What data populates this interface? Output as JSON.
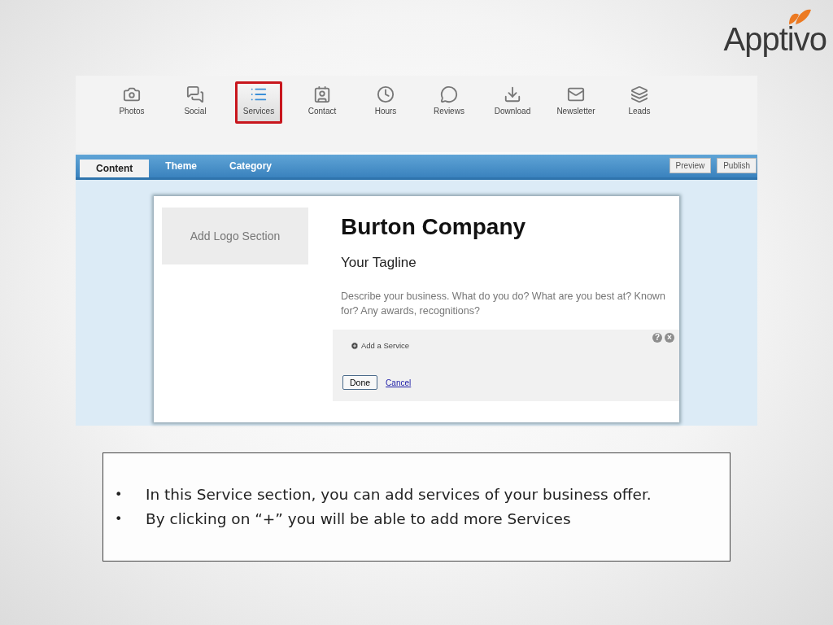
{
  "logo": {
    "text": "Apptivo"
  },
  "toolbar": {
    "items": [
      {
        "label": "Photos",
        "kind": "camera",
        "selected": false
      },
      {
        "label": "Social",
        "kind": "chat",
        "selected": false
      },
      {
        "label": "Services",
        "kind": "list",
        "selected": true
      },
      {
        "label": "Contact",
        "kind": "card",
        "selected": false
      },
      {
        "label": "Hours",
        "kind": "clock",
        "selected": false
      },
      {
        "label": "Reviews",
        "kind": "bubble",
        "selected": false
      },
      {
        "label": "Download",
        "kind": "download",
        "selected": false
      },
      {
        "label": "Newsletter",
        "kind": "mail",
        "selected": false
      },
      {
        "label": "Leads",
        "kind": "stack",
        "selected": false
      }
    ]
  },
  "tabs": [
    {
      "label": "Content",
      "selected": true
    },
    {
      "label": "Theme",
      "selected": false
    },
    {
      "label": "Category",
      "selected": false
    }
  ],
  "actions": [
    "Preview",
    "Publish"
  ],
  "page": {
    "logo_placeholder": "Add Logo Section",
    "company": "Burton Company",
    "tagline": "Your Tagline",
    "description": "Describe your business. What do you do? What are you best at? Known for? Any awards, recognitions?",
    "services_editor": {
      "add_label": "Add a Service",
      "help": "?",
      "close": "×",
      "done": "Done",
      "cancel": "Cancel"
    }
  },
  "notes": [
    {
      "bullet": "•",
      "text": "In this Service section, you can add services of your business offer."
    },
    {
      "bullet": "•",
      "text": "By clicking on “+” you will be able to add more Services"
    }
  ]
}
